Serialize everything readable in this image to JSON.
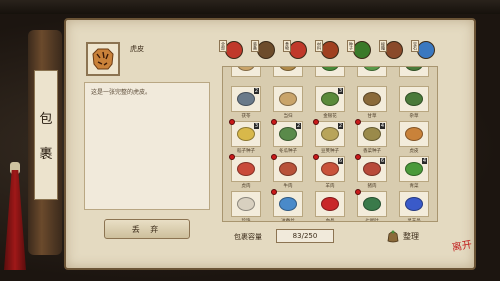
{
  "topbar": {
    "items": [
      "",
      "",
      "",
      ""
    ]
  },
  "scroll": {
    "chars": [
      "包",
      "裹"
    ]
  },
  "selected": {
    "name": "虎皮",
    "description": "这是一张完整的虎皮。"
  },
  "buttons": {
    "discard": "丢 弃",
    "sort": "整理"
  },
  "tabs": [
    {
      "label": "全部",
      "color": "#c0392b"
    },
    {
      "label": "装备",
      "color": "#6d4c2b"
    },
    {
      "label": "食物",
      "color": "#c0392b"
    },
    {
      "label": "材料",
      "color": "#a04020"
    },
    {
      "label": "种子",
      "color": "#3a7a2a"
    },
    {
      "label": "秘籍",
      "color": "#8a4a2a"
    },
    {
      "label": "宝石",
      "color": "#3a78c0"
    }
  ],
  "grid": {
    "rows": [
      [
        {
          "label": "",
          "color": "#c9a46a",
          "count": "",
          "dot": false
        },
        {
          "label": "",
          "color": "#b08a4a",
          "count": "",
          "dot": false
        },
        {
          "label": "",
          "color": "#4a8a3a",
          "count": "",
          "dot": false
        },
        {
          "label": "",
          "color": "#5a9a4a",
          "count": "",
          "dot": false
        },
        {
          "label": "",
          "color": "#4a7a3a",
          "count": "",
          "dot": false
        }
      ],
      [
        {
          "label": "茯苓",
          "color": "#6a7a8a",
          "count": "2",
          "dot": false
        },
        {
          "label": "当归",
          "color": "#c9a46a",
          "count": "",
          "dot": false
        },
        {
          "label": "金银花",
          "color": "#5a8a3a",
          "count": "3",
          "dot": false
        },
        {
          "label": "甘草",
          "color": "#8a6a3a",
          "count": "",
          "dot": false
        },
        {
          "label": "杂草",
          "color": "#4a7a3a",
          "count": "",
          "dot": false
        }
      ],
      [
        {
          "label": "稻子种子",
          "color": "#d8b84a",
          "count": "3",
          "dot": true
        },
        {
          "label": "冬瓜种子",
          "color": "#5a8a4a",
          "count": "2",
          "dot": true
        },
        {
          "label": "豆荚种子",
          "color": "#b8a45a",
          "count": "2",
          "dot": true
        },
        {
          "label": "香菜种子",
          "color": "#9a8a4a",
          "count": "4",
          "dot": true
        },
        {
          "label": "虎皮",
          "color": "#c9823a",
          "count": "",
          "dot": false
        }
      ],
      [
        {
          "label": "虎肉",
          "color": "#c94a3a",
          "count": "",
          "dot": true
        },
        {
          "label": "牛肉",
          "color": "#b8523a",
          "count": "",
          "dot": true
        },
        {
          "label": "羊肉",
          "color": "#c9523a",
          "count": "6",
          "dot": true
        },
        {
          "label": "猪肉",
          "color": "#b84a3a",
          "count": "6",
          "dot": true
        },
        {
          "label": "青菜",
          "color": "#4a9a3a",
          "count": "4",
          "dot": false
        }
      ],
      [
        {
          "label": "珍珠",
          "color": "#d8d0c0",
          "count": "",
          "dot": false
        },
        {
          "label": "冰蚕丝",
          "color": "#4a8ac9",
          "count": "",
          "dot": true
        },
        {
          "label": "血晶",
          "color": "#c9282a",
          "count": "",
          "dot": false
        },
        {
          "label": "七星叶",
          "color": "#3a7a4a",
          "count": "",
          "dot": true
        },
        {
          "label": "灵玉晶",
          "color": "#3a5ac9",
          "count": "",
          "dot": false
        }
      ]
    ]
  },
  "capacity": {
    "label": "包裹容量",
    "value": "83/250"
  },
  "seal": "离开"
}
